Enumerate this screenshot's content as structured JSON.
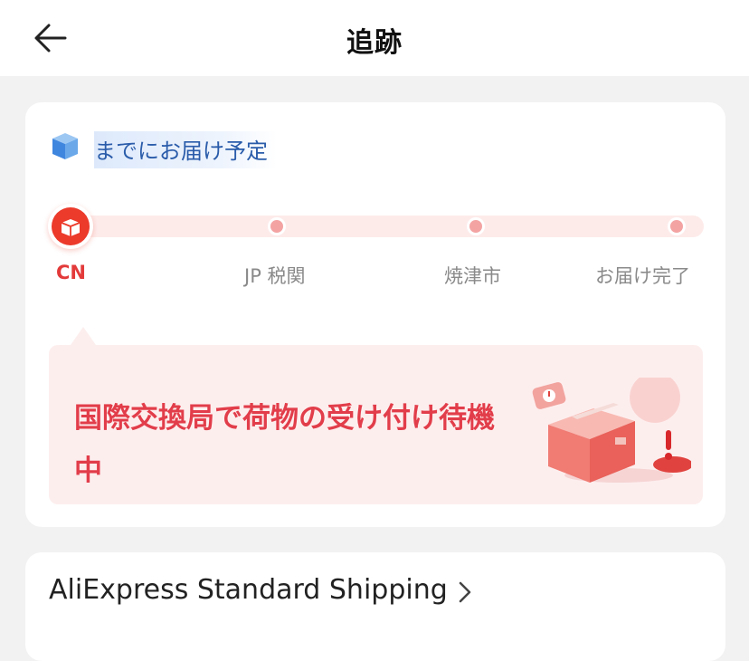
{
  "header": {
    "title": "追跡"
  },
  "estimate": {
    "text": "までにお届け予定"
  },
  "progress": {
    "steps": [
      {
        "label": "CN"
      },
      {
        "label": "JP 税関"
      },
      {
        "label": "焼津市"
      },
      {
        "label": "お届け完了"
      }
    ],
    "current_step": 0
  },
  "status": {
    "message": "国際交換局で荷物の受け付け待機中"
  },
  "shipping": {
    "method": "AliExpress Standard Shipping"
  },
  "colors": {
    "accent": "#e23d4a",
    "link": "#2a5caa",
    "track": "#fdebea"
  }
}
